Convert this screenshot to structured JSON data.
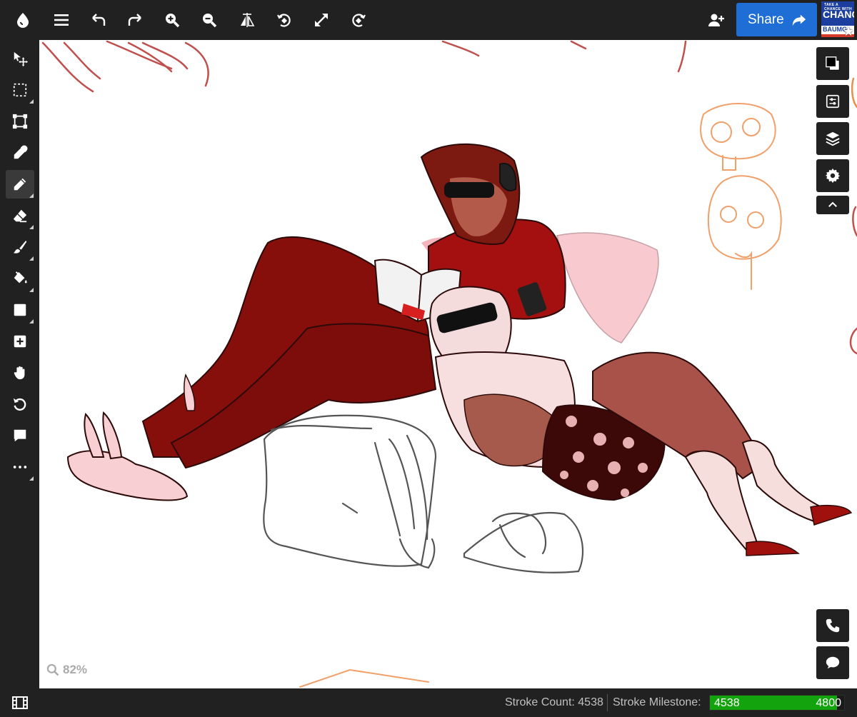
{
  "app": {
    "logo_icon": "droplet-logo-icon",
    "accent_color": "#1e6ed6",
    "progress_color": "#13a40d"
  },
  "toolbar": {
    "items": [
      "menu-icon",
      "undo-icon",
      "redo-icon",
      "zoom-in-icon",
      "zoom-out-icon",
      "flip-view-icon",
      "rotate-left-icon",
      "fullscreen-icon",
      "rotate-right-icon"
    ],
    "add_user_icon": "add-user-icon",
    "share_label": "Share",
    "share_icon": "share-arrow-icon"
  },
  "avatar": {
    "line1": "TAKE A CHANCE WITH",
    "line2": "CHANCE",
    "line3": "BAUMG"
  },
  "tools": [
    {
      "name": "move-tool",
      "icon": "move-icon",
      "submenu": false
    },
    {
      "name": "select-tool",
      "icon": "marquee-select-icon",
      "submenu": true
    },
    {
      "name": "transform-tool",
      "icon": "transform-icon",
      "submenu": false
    },
    {
      "name": "eyedropper-tool",
      "icon": "eyedropper-icon",
      "submenu": false
    },
    {
      "name": "pen-tool",
      "icon": "pencil-icon",
      "submenu": true,
      "active": true
    },
    {
      "name": "eraser-tool",
      "icon": "eraser-icon",
      "submenu": true
    },
    {
      "name": "smudge-tool",
      "icon": "brush-icon",
      "submenu": true
    },
    {
      "name": "fill-tool",
      "icon": "paint-bucket-icon",
      "submenu": true
    },
    {
      "name": "shape-tool",
      "icon": "square-icon",
      "submenu": true
    },
    {
      "name": "add-layer-tool",
      "icon": "plus-square-icon",
      "submenu": false
    },
    {
      "name": "hand-tool",
      "icon": "hand-icon",
      "submenu": false
    },
    {
      "name": "reset-tool",
      "icon": "reset-icon",
      "submenu": false
    },
    {
      "name": "comment-tool",
      "icon": "comment-icon",
      "submenu": false
    },
    {
      "name": "more-tool",
      "icon": "ellipsis-icon",
      "submenu": true
    }
  ],
  "right_panel": {
    "color_icon": "color-swatch-icon",
    "primary_color": "#000000",
    "secondary_color": "#ffffff",
    "adjust_icon": "adjustments-icon",
    "layers_icon": "layers-icon",
    "settings_icon": "gear-icon",
    "collapse_icon": "chevron-up-icon",
    "call_icon": "phone-icon",
    "chat_icon": "chat-bubble-icon"
  },
  "zoom": {
    "icon": "magnifier-icon",
    "value": "82%"
  },
  "status": {
    "filmstrip_icon": "filmstrip-icon",
    "stroke_count_label": "Stroke Count: 4538",
    "stroke_milestone_label": "Stroke Milestone:",
    "progress_current": "4538",
    "progress_max": "4800",
    "progress_fraction": 0.945
  }
}
